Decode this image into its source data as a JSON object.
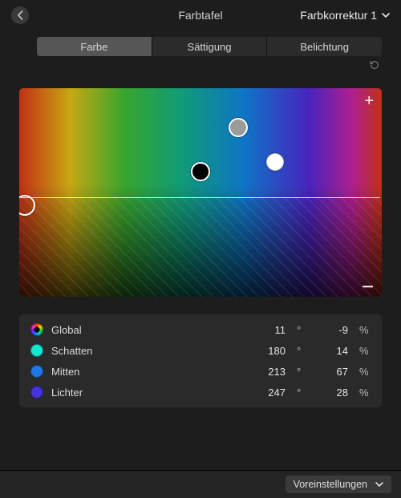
{
  "header": {
    "title": "Farbtafel",
    "corrector_label": "Farbkorrektur 1"
  },
  "tabs": {
    "color": "Farbe",
    "saturation": "Sättigung",
    "exposure": "Belichtung",
    "active": "color"
  },
  "icons": {
    "plus": "+",
    "minus": "−"
  },
  "params": {
    "degree_unit": "°",
    "percent_unit": "%",
    "rows": [
      {
        "key": "global",
        "label": "Global",
        "hue": 11,
        "pct": -9,
        "swatch": "sw-global"
      },
      {
        "key": "shadows",
        "label": "Schatten",
        "hue": 180,
        "pct": 14,
        "swatch": "sw-shadows"
      },
      {
        "key": "mids",
        "label": "Mitten",
        "hue": 213,
        "pct": 67,
        "swatch": "sw-mids"
      },
      {
        "key": "highs",
        "label": "Lichter",
        "hue": 247,
        "pct": 28,
        "swatch": "sw-highs"
      }
    ]
  },
  "footer": {
    "presets_label": "Voreinstellungen"
  }
}
